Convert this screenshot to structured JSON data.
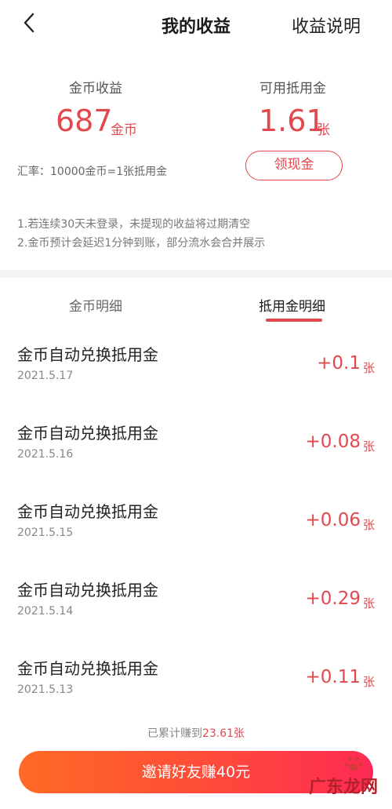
{
  "header": {
    "title": "我的收益",
    "explain_label": "收益说明"
  },
  "summary": {
    "coins_label": "金币收益",
    "coins_value": "687",
    "coins_unit": "金币",
    "voucher_label": "可用抵用金",
    "voucher_value": "1.61",
    "voucher_unit": "张",
    "rate_text": "汇率：10000金币=1张抵用金",
    "withdraw_label": "领现金",
    "notes": [
      "1.若连续30天未登录，未提现的收益将过期清空",
      "2.金币预计会延迟1分钟到账，部分流水会合并展示"
    ]
  },
  "tabs": [
    {
      "label": "金币明细",
      "active": false
    },
    {
      "label": "抵用金明细",
      "active": true
    }
  ],
  "records": [
    {
      "title": "金币自动兑换抵用金",
      "date": "2021.5.17",
      "amount": "+0.1",
      "unit": "张"
    },
    {
      "title": "金币自动兑换抵用金",
      "date": "2021.5.16",
      "amount": "+0.08",
      "unit": "张"
    },
    {
      "title": "金币自动兑换抵用金",
      "date": "2021.5.15",
      "amount": "+0.06",
      "unit": "张"
    },
    {
      "title": "金币自动兑换抵用金",
      "date": "2021.5.14",
      "amount": "+0.29",
      "unit": "张"
    },
    {
      "title": "金币自动兑换抵用金",
      "date": "2021.5.13",
      "amount": "+0.11",
      "unit": "张"
    }
  ],
  "footer": {
    "total_prefix": "已累计赚到",
    "total_value": "23.61张",
    "invite_label": "邀请好友赚40元",
    "watermark": "广东龙网"
  },
  "colors": {
    "accent": "#e4484f",
    "button_gradient_start": "#ff6a26",
    "button_gradient_end": "#ff2a55"
  },
  "icons": {
    "back": "chevron-left-icon",
    "paw": "paw-icon"
  }
}
